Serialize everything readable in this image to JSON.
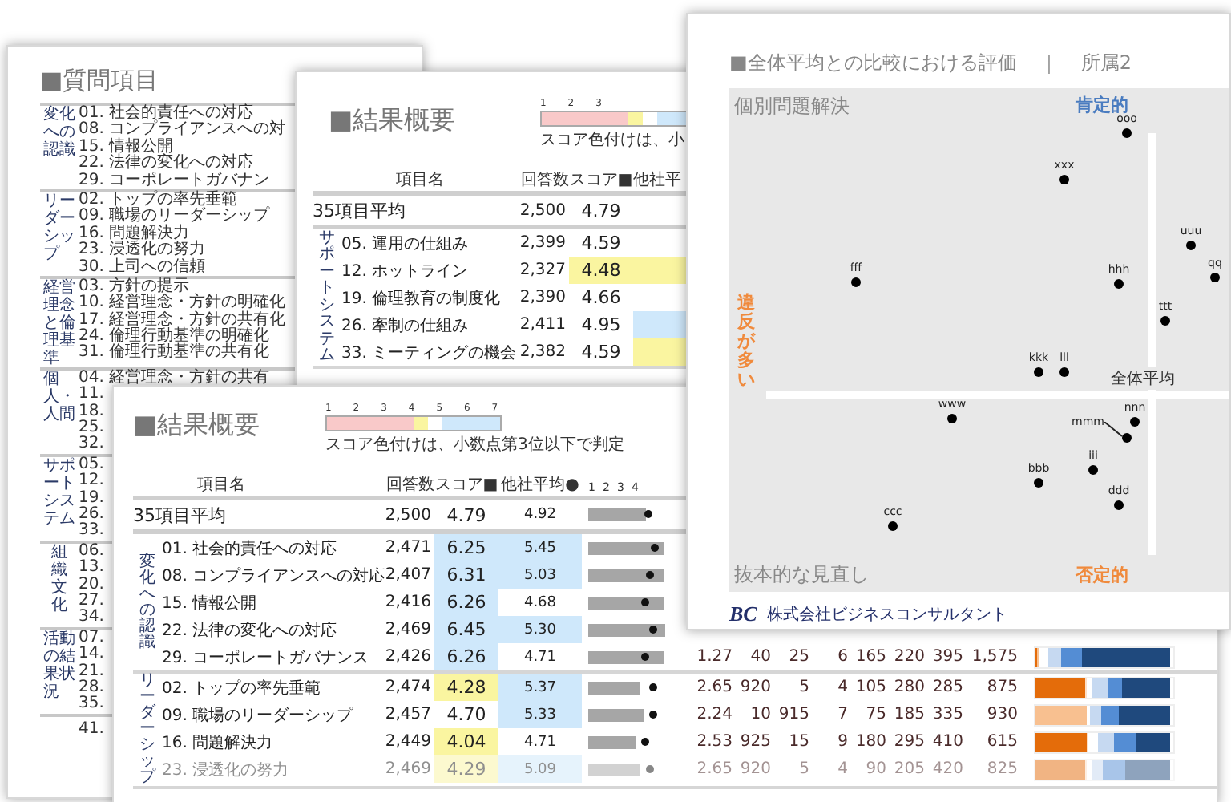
{
  "question_page": {
    "title": "■質問項目",
    "groups": [
      {
        "label": "変化への認識",
        "items": [
          "01. 社会的責任への対応",
          "08. コンプライアンスへの対",
          "15. 情報公開",
          "22. 法律の変化への対応",
          "29. コーポレートガバナン"
        ]
      },
      {
        "label": "リーダーシップ",
        "items": [
          "02. トップの率先垂範",
          "09. 職場のリーダーシップ",
          "16. 問題解決力",
          "23. 浸透化の努力",
          "30. 上司への信頼"
        ]
      },
      {
        "label": "経営理念と倫理基準",
        "items": [
          "03. 方針の提示",
          "10. 経営理念・方針の明確化",
          "17. 経営理念・方針の共有化",
          "24. 倫理行動基準の明確化",
          "31. 倫理行動基準の共有化"
        ]
      },
      {
        "label": "個人・人間",
        "items": [
          "04. 経営理念・方針の共有",
          "11.",
          "18.",
          "25.",
          "32."
        ]
      },
      {
        "label": "サポートシステム",
        "items": [
          "05.",
          "12.",
          "19.",
          "26.",
          "33."
        ]
      },
      {
        "label": "組織文化",
        "items": [
          "06.",
          "13.",
          "20.",
          "27.",
          "34."
        ]
      },
      {
        "label": "活動の結果状況",
        "items": [
          "07.",
          "14.",
          "21.",
          "28.",
          "35."
        ]
      },
      {
        "items": [
          "41."
        ]
      }
    ]
  },
  "summary_page_back": {
    "title": "■結果概要",
    "legend": {
      "ticks": [
        "1",
        "2",
        "3"
      ],
      "note": "スコア色付けは、小"
    },
    "columns": [
      "項目名",
      "回答数",
      "スコア■",
      "他社平"
    ],
    "average_row": {
      "name": "35項目平均",
      "count": "2,500",
      "score": "4.79"
    },
    "groups": [
      {
        "label": "サポートシステム",
        "rows": [
          {
            "name": "05. 運用の仕組み",
            "count": "2,399",
            "score": "4.59",
            "score_high": false,
            "score_low": false,
            "avg_high": false,
            "avg_low": false
          },
          {
            "name": "12. ホットライン",
            "count": "2,327",
            "score": "4.48",
            "score_high": false,
            "score_low": true,
            "avg_high": false,
            "avg_low": true
          },
          {
            "name": "19. 倫理教育の制度化",
            "count": "2,390",
            "score": "4.66",
            "score_high": false,
            "score_low": false,
            "avg_high": false,
            "avg_low": false
          },
          {
            "name": "26. 牽制の仕組み",
            "count": "2,411",
            "score": "4.95",
            "score_high": false,
            "score_low": false,
            "avg_high": true,
            "avg_low": false
          },
          {
            "name": "33. ミーティングの機会",
            "count": "2,382",
            "score": "4.59",
            "score_high": false,
            "score_low": false,
            "avg_high": false,
            "avg_low": true
          }
        ]
      }
    ]
  },
  "summary_page_front": {
    "title": "■結果概要",
    "legend": {
      "ticks": [
        "1",
        "2",
        "3",
        "4",
        "5",
        "6",
        "7"
      ],
      "note": "スコア色付けは、小数点第3位以下で判定"
    },
    "columns": [
      "項目名",
      "回答数",
      "スコア■",
      "他社平均●"
    ],
    "scale_ticks": [
      "1",
      "2",
      "3",
      "4"
    ],
    "average_row": {
      "name": "35項目平均",
      "count": "2,500",
      "score": "4.79",
      "avg": "4.92"
    },
    "groups": [
      {
        "label": "変化への認識",
        "rows": [
          {
            "name": "01. 社会的責任への対応",
            "count": "2,471",
            "score": "6.25",
            "score_high": true,
            "score_low": false,
            "avg": "5.45",
            "avg_high": true,
            "avg_low": false
          },
          {
            "name": "08. コンプライアンスへの対応",
            "count": "2,407",
            "score": "6.31",
            "score_high": true,
            "score_low": false,
            "avg": "5.03",
            "avg_high": true,
            "avg_low": false
          },
          {
            "name": "15. 情報公開",
            "count": "2,416",
            "score": "6.26",
            "score_high": true,
            "score_low": false,
            "avg": "4.68",
            "avg_high": false,
            "avg_low": false
          },
          {
            "name": "22. 法律の変化への対応",
            "count": "2,469",
            "score": "6.45",
            "score_high": true,
            "score_low": false,
            "avg": "5.30",
            "avg_high": true,
            "avg_low": false
          },
          {
            "name": "29. コーポレートガバナンス",
            "count": "2,426",
            "score": "6.26",
            "score_high": true,
            "score_low": false,
            "avg": "4.71",
            "avg_high": false,
            "avg_low": false,
            "stats": [
              "1.27",
              "40",
              "25",
              "6",
              "165",
              "220",
              "395",
              "1,575"
            ]
          }
        ]
      },
      {
        "label": "リーダーシップ",
        "rows": [
          {
            "name": "02. トップの率先垂範",
            "count": "2,474",
            "score": "4.28",
            "score_high": false,
            "score_low": true,
            "avg": "5.37",
            "avg_high": true,
            "avg_low": false,
            "stats": [
              "2.65",
              "920",
              "5",
              "4",
              "105",
              "280",
              "285",
              "875"
            ]
          },
          {
            "name": "09. 職場のリーダーシップ",
            "count": "2,457",
            "score": "4.70",
            "score_high": false,
            "score_low": false,
            "avg": "5.33",
            "avg_high": true,
            "avg_low": false,
            "stats": [
              "2.24",
              "10",
              "915",
              "7",
              "75",
              "185",
              "335",
              "930"
            ]
          },
          {
            "name": "16. 問題解決力",
            "count": "2,449",
            "score": "4.04",
            "score_high": false,
            "score_low": true,
            "avg": "4.71",
            "avg_high": false,
            "avg_low": false,
            "stats": [
              "2.53",
              "925",
              "15",
              "9",
              "180",
              "295",
              "410",
              "615"
            ]
          },
          {
            "name": "23. 浸透化の努力",
            "count": "2,469",
            "score": "4.29",
            "score_high": false,
            "score_low": true,
            "avg": "5.09",
            "avg_high": true,
            "avg_low": false,
            "stats": [
              "2.65",
              "920",
              "5",
              "4",
              "90",
              "205",
              "420",
              "825"
            ]
          }
        ]
      }
    ]
  },
  "evaluation_page": {
    "title": "■全体平均との比較における評価",
    "separator": "｜",
    "department": "所属2",
    "quadrants": {
      "top_left": "個別問題解決",
      "top": "肯定的",
      "left": "違反が多い",
      "bottom_left": "抜本的な見直し",
      "bottom": "否定的"
    },
    "center_label": "全体平均",
    "points": [
      {
        "label": "ooo",
        "leader": false
      },
      {
        "label": "xxx",
        "leader": false
      },
      {
        "label": "uuu",
        "leader": false
      },
      {
        "label": "fff",
        "leader": false
      },
      {
        "label": "hhh",
        "leader": false
      },
      {
        "label": "qq",
        "leader": false
      },
      {
        "label": "ttt",
        "leader": false
      },
      {
        "label": "kkk",
        "leader": false
      },
      {
        "label": "lll",
        "leader": false
      },
      {
        "label": "www",
        "leader": false
      },
      {
        "label": "mmm",
        "leader": true
      },
      {
        "label": "nnn",
        "leader": false
      },
      {
        "label": "iii",
        "leader": false
      },
      {
        "label": "bbb",
        "leader": false
      },
      {
        "label": "ddd",
        "leader": false
      },
      {
        "label": "ccc",
        "leader": false
      }
    ],
    "footer": {
      "logo": "BC",
      "company": "株式会社ビジネスコンサルタント"
    }
  }
}
